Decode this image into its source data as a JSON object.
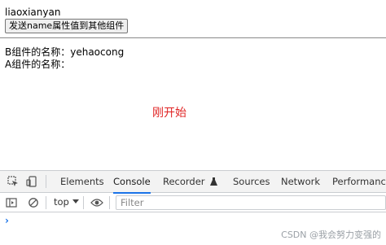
{
  "page": {
    "name_a": "liaoxianyan",
    "send_button_label": "发送name属性值到其他组件",
    "b_component_line": "B组件的名称：yehaocong",
    "a_component_line": "A组件的名称：",
    "status_text": "刚开始"
  },
  "devtools": {
    "tabs": [
      "Elements",
      "Console",
      "Recorder",
      "Sources",
      "Network",
      "Performance"
    ],
    "active_tab": "Console",
    "context_selector": "top",
    "filter_placeholder": "Filter",
    "console_prompt": "›",
    "icons": {
      "inspect": "inspect-element-icon",
      "device": "device-toolbar-icon",
      "recorder_badge": "flask-icon",
      "sidebar": "show-sidebar-icon",
      "clear": "clear-console-icon",
      "eye": "live-expression-eye-icon",
      "dropdown": "chevron-down-icon"
    }
  },
  "watermark": "CSDN @我会努力变强的",
  "colors": {
    "status_red": "#e02424",
    "active_tab_underline": "#1a73e8",
    "prompt_blue": "#1a73e8"
  }
}
